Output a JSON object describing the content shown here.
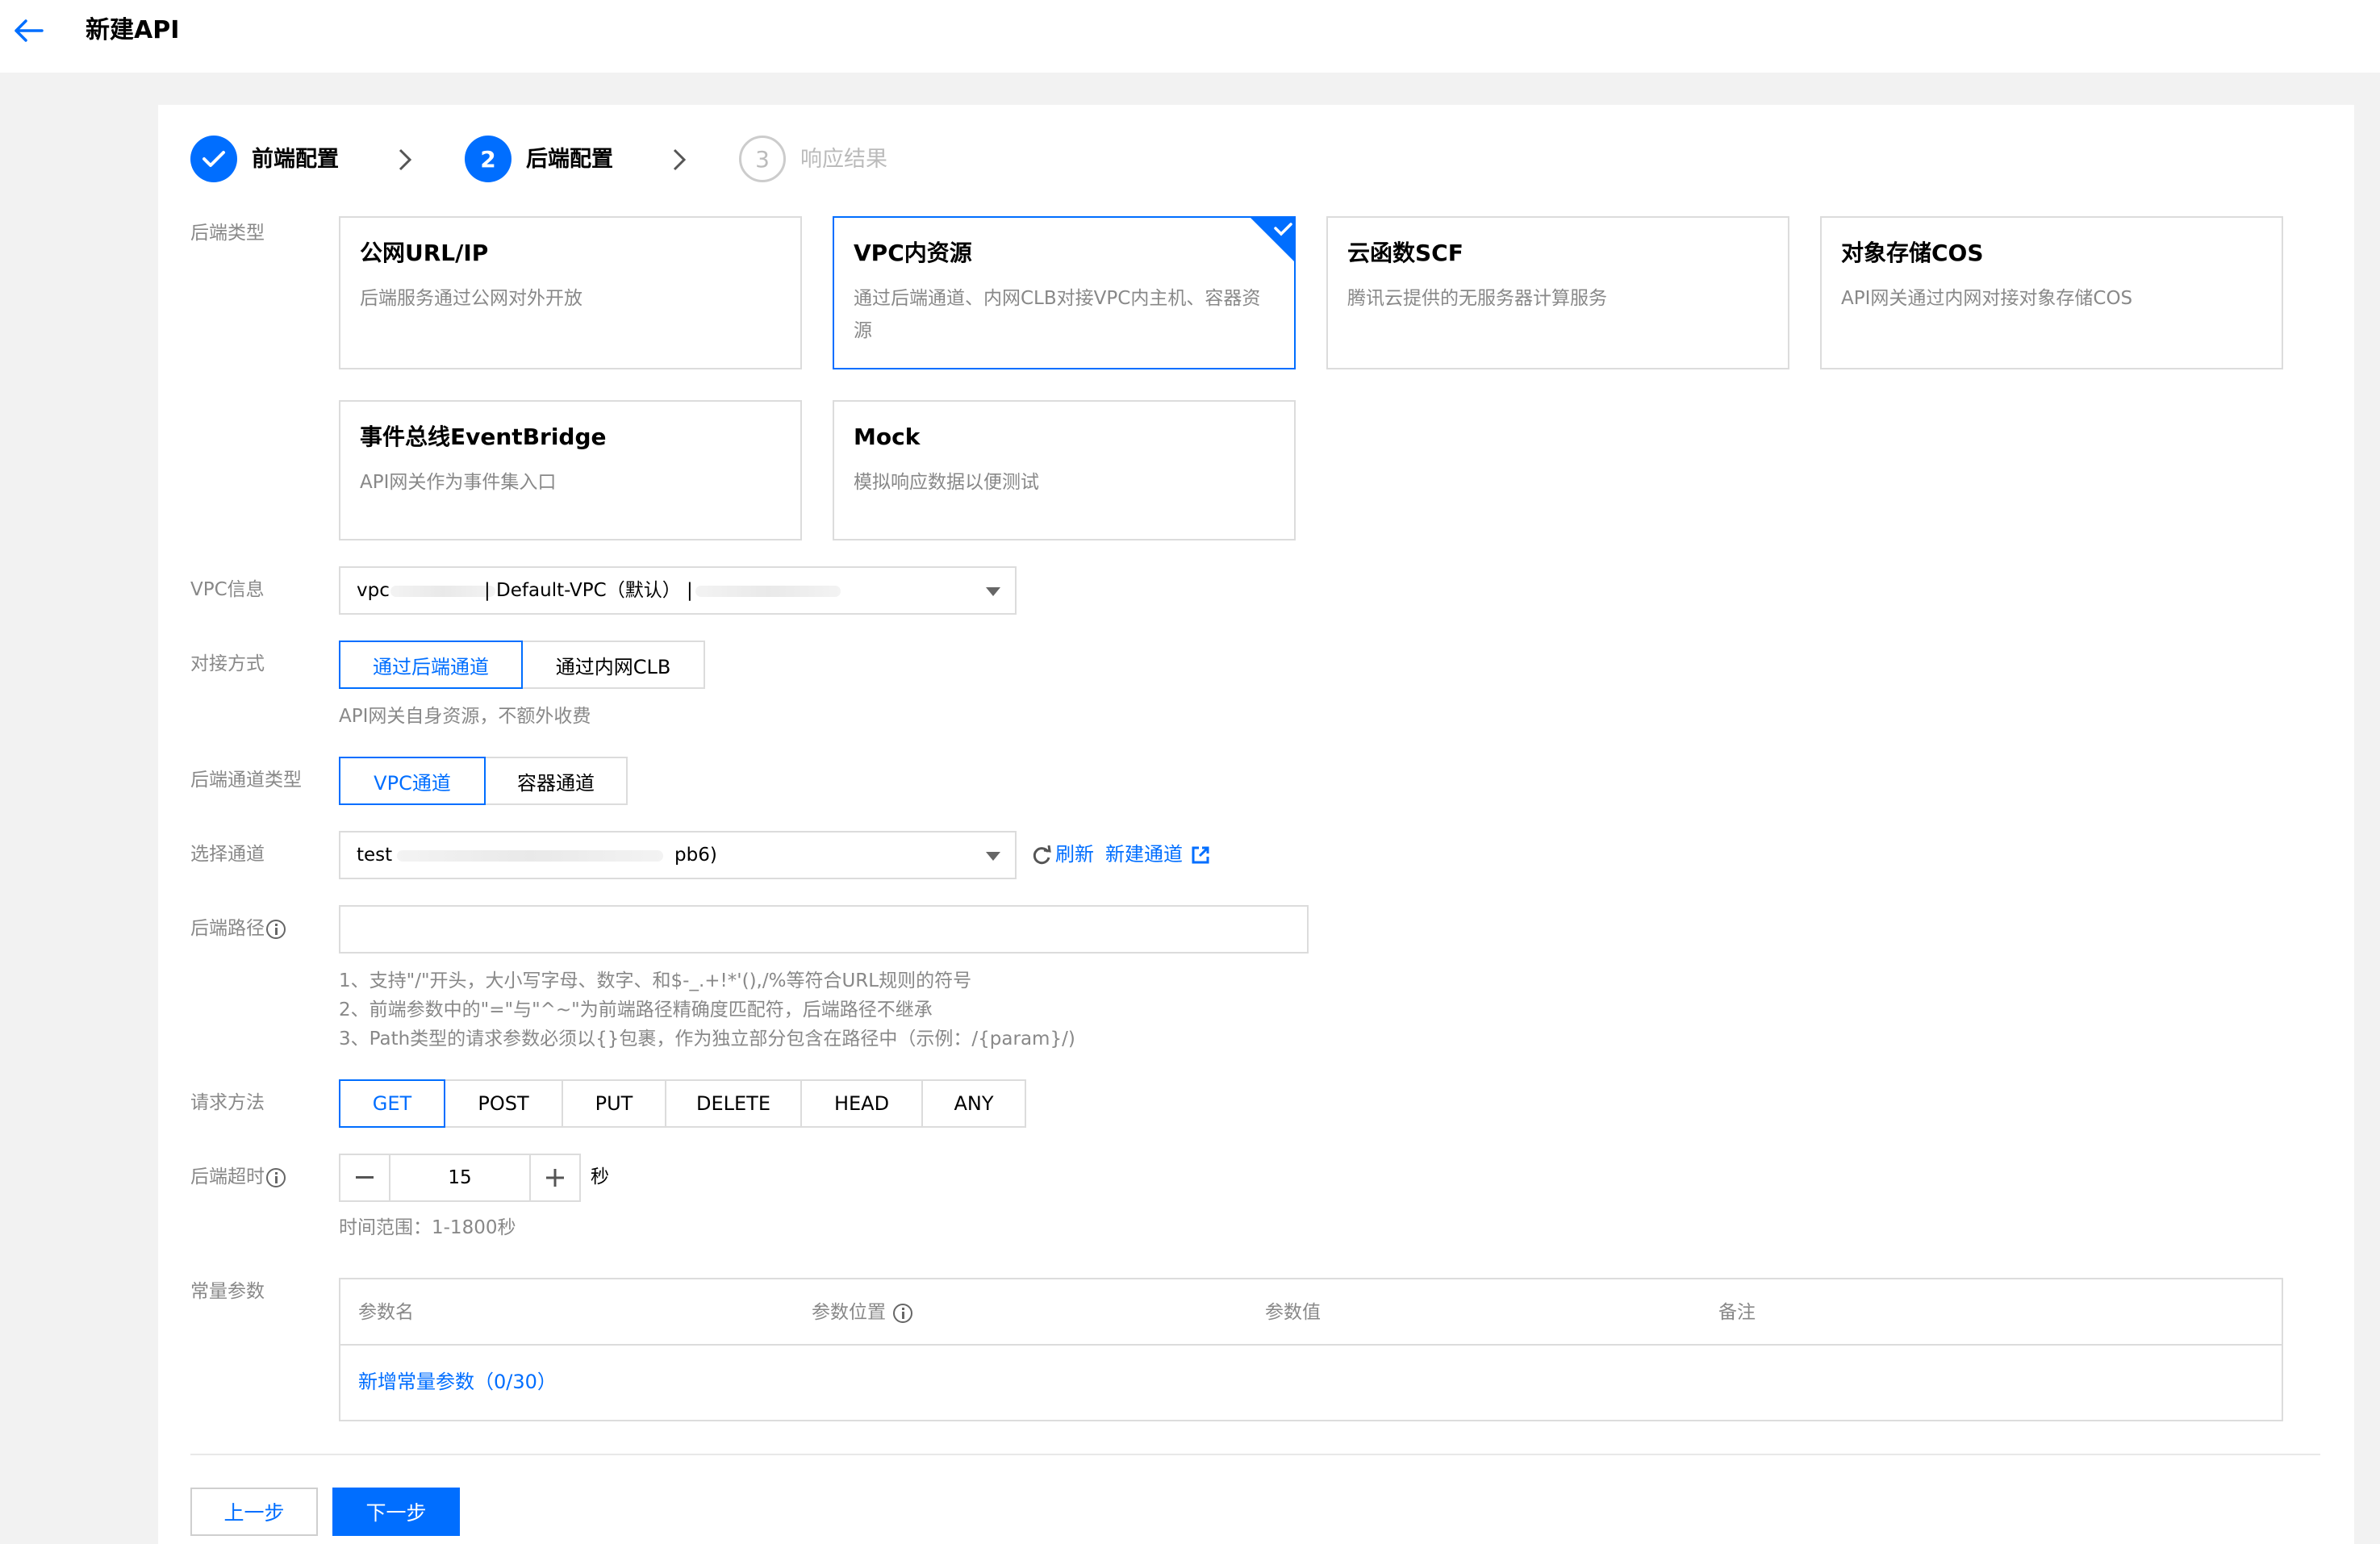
{
  "header": {
    "title": "新建API"
  },
  "steps": [
    {
      "num": "✓",
      "label": "前端配置",
      "state": "done"
    },
    {
      "num": "2",
      "label": "后端配置",
      "state": "active"
    },
    {
      "num": "3",
      "label": "响应结果",
      "state": "pending"
    }
  ],
  "backend_type": {
    "label": "后端类型",
    "options": [
      {
        "title": "公网URL/IP",
        "desc": "后端服务通过公网对外开放"
      },
      {
        "title": "VPC内资源",
        "desc": "通过后端通道、内网CLB对接VPC内主机、容器资源",
        "selected": true
      },
      {
        "title": "云函数SCF",
        "desc": "腾讯云提供的无服务器计算服务"
      },
      {
        "title": "对象存储COS",
        "desc": "API网关通过内网对接对象存储COS"
      },
      {
        "title": "事件总线EventBridge",
        "desc": "API网关作为事件集入口"
      },
      {
        "title": "Mock",
        "desc": "模拟响应数据以便测试"
      }
    ]
  },
  "vpc_info": {
    "label": "VPC信息",
    "value_prefix": "vpc",
    "value_mid": "| Default-VPC（默认） |"
  },
  "connect_mode": {
    "label": "对接方式",
    "options": [
      "通过后端通道",
      "通过内网CLB"
    ],
    "selected": "通过后端通道",
    "hint": "API网关自身资源，不额外收费"
  },
  "channel_type": {
    "label": "后端通道类型",
    "options": [
      "VPC通道",
      "容器通道"
    ],
    "selected": "VPC通道"
  },
  "channel_select": {
    "label": "选择通道",
    "value_prefix": "test",
    "value_suffix": "pb6)",
    "refresh": "刷新",
    "create": "新建通道"
  },
  "backend_path": {
    "label": "后端路径",
    "value": "",
    "hints": [
      "1、支持\"/\"开头，大小写字母、数字、和$-_.+!*'(),/%等符合URL规则的符号",
      "2、前端参数中的\"=\"与\"^~\"为前端路径精确度匹配符，后端路径不继承",
      "3、Path类型的请求参数必须以{}包裹，作为独立部分包含在路径中（示例：/{param}/)"
    ]
  },
  "method": {
    "label": "请求方法",
    "options": [
      "GET",
      "POST",
      "PUT",
      "DELETE",
      "HEAD",
      "ANY"
    ],
    "selected": "GET"
  },
  "timeout": {
    "label": "后端超时",
    "value": "15",
    "unit": "秒",
    "hint": "时间范围：1-1800秒"
  },
  "const_params": {
    "label": "常量参数",
    "columns": [
      "参数名",
      "参数位置",
      "参数值",
      "备注"
    ],
    "add_link": "新增常量参数（0/30）"
  },
  "footer": {
    "prev": "上一步",
    "next": "下一步"
  },
  "colors": {
    "accent": "#006eff",
    "border": "#dcdcdc",
    "muted": "#888888"
  }
}
